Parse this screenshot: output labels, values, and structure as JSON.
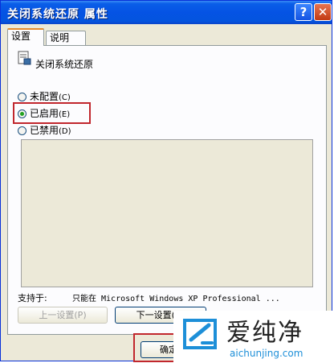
{
  "window": {
    "title": "关闭系统还原 属性",
    "help_label": "?",
    "close_label": "✕"
  },
  "tabs": [
    {
      "label": "设置"
    },
    {
      "label": "说明"
    }
  ],
  "policy": {
    "name": "关闭系统还原",
    "icon": "policy-setting-icon"
  },
  "options": [
    {
      "label": "未配置",
      "accel": "(C)",
      "selected": false
    },
    {
      "label": "已启用",
      "accel": "(E)",
      "selected": true
    },
    {
      "label": "已禁用",
      "accel": "(D)",
      "selected": false
    }
  ],
  "supported": {
    "label": "支持于:",
    "value": "只能在 Microsoft Windows XP Professional ..."
  },
  "buttons": {
    "prev": "上一设置(P)",
    "next": "下一设置(N)",
    "ok": "确定"
  },
  "watermark": {
    "title": "爱纯净",
    "url": "aichunjing.com"
  },
  "colors": {
    "highlight": "#c1272d",
    "title_bar": "#0553e4",
    "radio_selected": "#21a121",
    "watermark_url": "#1d8fd8"
  }
}
